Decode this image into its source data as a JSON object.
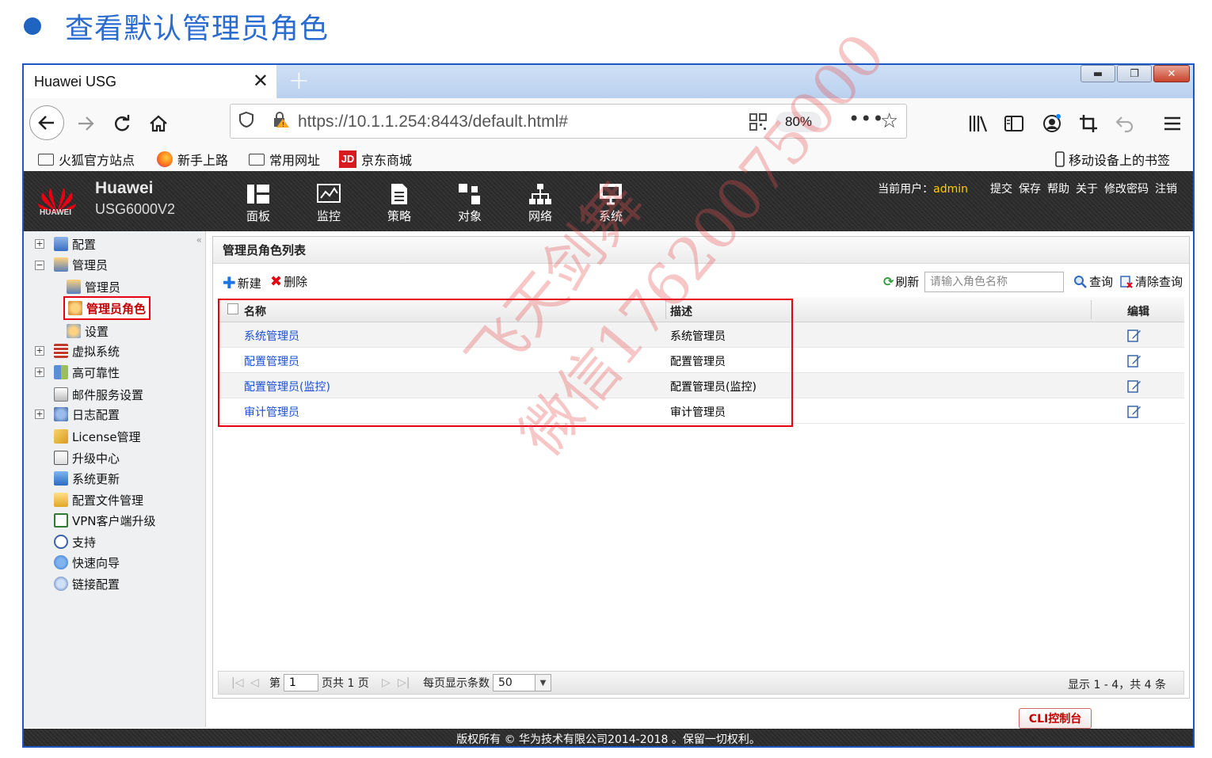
{
  "slide": {
    "title": "查看默认管理员角色"
  },
  "browser": {
    "tab_title": "Huawei USG",
    "tab_close": "✕",
    "new_tab": "+",
    "url_host": "https://10.1.1.254",
    "url_rest": ":8443/default.html#",
    "zoom": "80%",
    "bookmarks": [
      "火狐官方站点",
      "新手上路",
      "常用网址",
      "京东商城"
    ],
    "mobile_bookmarks": "移动设备上的书签",
    "jd_badge": "JD"
  },
  "app": {
    "brand_name": "Huawei",
    "brand_logo_text": "HUAWEI",
    "model": "USG6000V2",
    "menu": [
      "面板",
      "监控",
      "策略",
      "对象",
      "网络",
      "系统"
    ],
    "current_user_label": "当前用户：",
    "current_user": "admin",
    "header_links": [
      "提交",
      "保存",
      "帮助",
      "关于",
      "修改密码",
      "注销"
    ]
  },
  "sidebar": {
    "items": [
      {
        "label": "配置"
      },
      {
        "label": "管理员"
      },
      {
        "label": "管理员"
      },
      {
        "label": "管理员角色"
      },
      {
        "label": "设置"
      },
      {
        "label": "虚拟系统"
      },
      {
        "label": "高可靠性"
      },
      {
        "label": "邮件服务设置"
      },
      {
        "label": "日志配置"
      },
      {
        "label": "License管理"
      },
      {
        "label": "升级中心"
      },
      {
        "label": "系统更新"
      },
      {
        "label": "配置文件管理"
      },
      {
        "label": "VPN客户端升级"
      },
      {
        "label": "支持"
      },
      {
        "label": "快速向导"
      },
      {
        "label": "链接配置"
      }
    ]
  },
  "panel": {
    "title": "管理员角色列表",
    "new_label": "新建",
    "delete_label": "删除",
    "refresh_label": "刷新",
    "search_placeholder": "请输入角色名称",
    "query_label": "查询",
    "clear_label": "清除查询"
  },
  "grid": {
    "headers": {
      "name": "名称",
      "desc": "描述",
      "edit": "编辑"
    },
    "rows": [
      {
        "name": "系统管理员",
        "desc": "系统管理员"
      },
      {
        "name": "配置管理员",
        "desc": "配置管理员"
      },
      {
        "name": "配置管理员(监控)",
        "desc": "配置管理员(监控)"
      },
      {
        "name": "审计管理员",
        "desc": "审计管理员"
      }
    ]
  },
  "pager": {
    "page_prefix": "第",
    "page_value": "1",
    "page_suffix": "页共 1 页",
    "per_page_label": "每页显示条数",
    "per_page_value": "50",
    "summary": "显示 1 - 4，共 4 条"
  },
  "cli_button": "CLI控制台",
  "footer": "版权所有 © 华为技术有限公司2014-2018 。保留一切权利。",
  "watermark": {
    "line1": "飞天剑舞",
    "line2": "微信17620075000"
  },
  "colors": {
    "accent": "#1c58c4",
    "highlight": "#e60012",
    "link": "#1a4fd6",
    "user": "#ffcc00"
  }
}
